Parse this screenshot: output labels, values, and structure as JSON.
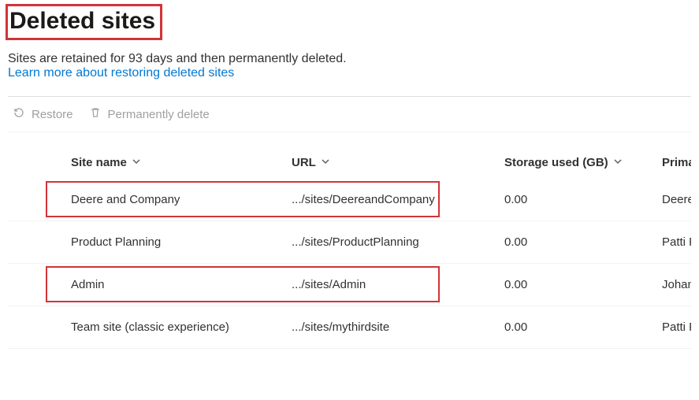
{
  "header": {
    "title": "Deleted sites",
    "retain_text": "Sites are retained for 93 days and then permanently deleted.",
    "learn_more": "Learn more about restoring deleted sites"
  },
  "toolbar": {
    "restore": "Restore",
    "perm_delete": "Permanently delete"
  },
  "columns": {
    "site_name": "Site name",
    "url": "URL",
    "storage": "Storage used (GB)",
    "admin": "Primary admin"
  },
  "rows": [
    {
      "name": "Deere and Company",
      "url": ".../sites/DeereandCompany",
      "storage": "0.00",
      "admin": "Deere a",
      "highlight": true
    },
    {
      "name": "Product Planning",
      "url": ".../sites/ProductPlanning",
      "storage": "0.00",
      "admin": "Patti Fer",
      "highlight": false
    },
    {
      "name": "Admin",
      "url": ".../sites/Admin",
      "storage": "0.00",
      "admin": "Johanna",
      "highlight": true
    },
    {
      "name": "Team site (classic experience)",
      "url": ".../sites/mythirdsite",
      "storage": "0.00",
      "admin": "Patti Fer",
      "highlight": false
    }
  ]
}
